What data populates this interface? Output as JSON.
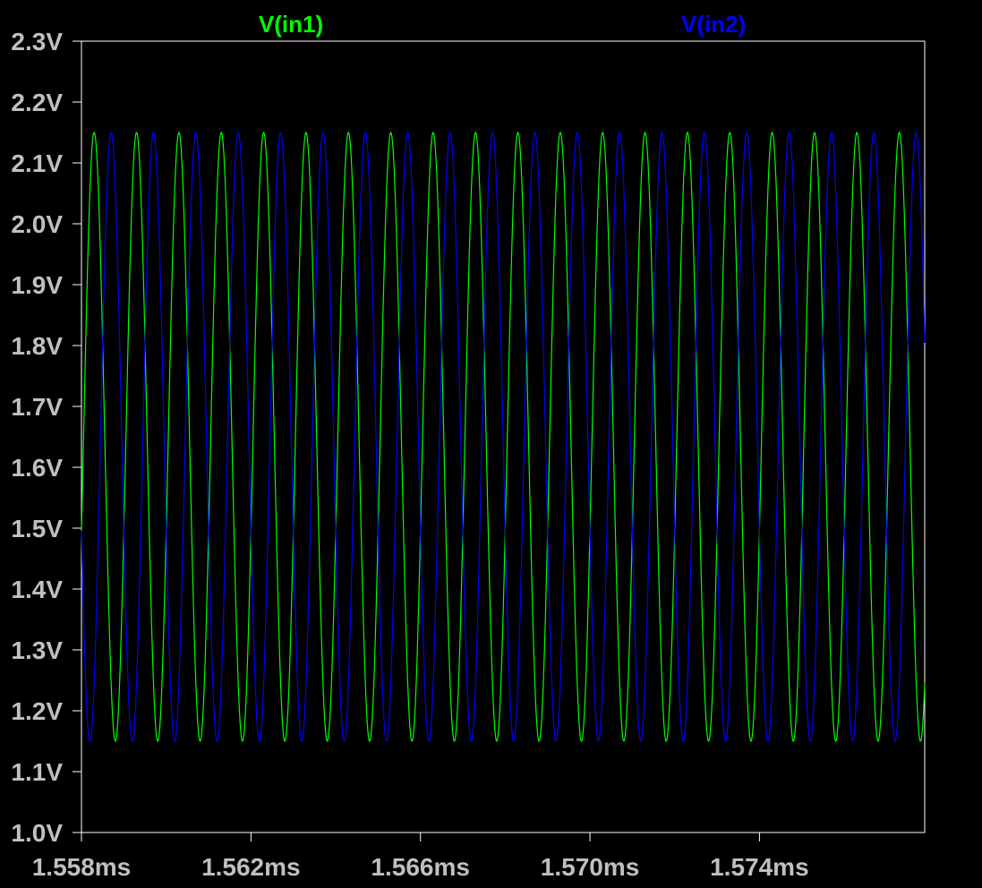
{
  "chart_data": {
    "type": "line",
    "title": "",
    "xlabel": "",
    "ylabel": "",
    "xlim": [
      1.558,
      1.5779
    ],
    "ylim": [
      1.0,
      2.3
    ],
    "x_unit": "ms",
    "y_unit": "V",
    "xticks": [
      1.558,
      1.562,
      1.566,
      1.57,
      1.574
    ],
    "xtick_labels": [
      "1.558ms",
      "1.562ms",
      "1.566ms",
      "1.570ms",
      "1.574ms"
    ],
    "yticks": [
      1.0,
      1.1,
      1.2,
      1.3,
      1.4,
      1.5,
      1.6,
      1.7,
      1.8,
      1.9,
      2.0,
      2.1,
      2.2,
      2.3
    ],
    "ytick_labels": [
      "1.0V",
      "1.1V",
      "1.2V",
      "1.3V",
      "1.4V",
      "1.5V",
      "1.6V",
      "1.7V",
      "1.8V",
      "1.9V",
      "2.0V",
      "2.1V",
      "2.2V",
      "2.3V"
    ],
    "grid": false,
    "legend": "top",
    "series": [
      {
        "name": "V(in1)",
        "color": "#00ff00",
        "waveform": "sine",
        "offset": 1.65,
        "amplitude": 0.5,
        "frequency_khz": 1000,
        "first_peak_ms": 1.5583
      },
      {
        "name": "V(in2)",
        "color": "#0000ff",
        "waveform": "sine",
        "offset": 1.65,
        "amplitude": 0.5,
        "frequency_khz": 1000,
        "first_peak_ms": 1.5587
      }
    ]
  },
  "colors": {
    "background": "#000000",
    "frame": "#ffffff",
    "tick_label": "#c0c0c0"
  }
}
